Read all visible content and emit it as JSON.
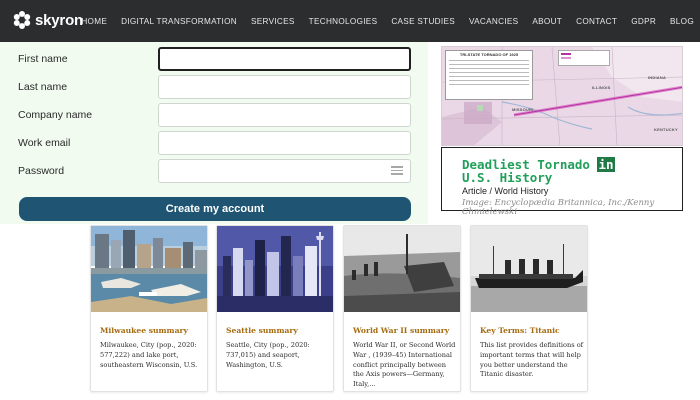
{
  "brand": {
    "name": "skyron"
  },
  "nav": {
    "items": [
      "HOME",
      "DIGITAL TRANSFORMATION",
      "SERVICES",
      "TECHNOLOGIES",
      "CASE STUDIES",
      "VACANCIES",
      "ABOUT",
      "CONTACT",
      "GDPR",
      "BLOG"
    ]
  },
  "form": {
    "first_name": {
      "label": "First name",
      "value": ""
    },
    "last_name": {
      "label": "Last name",
      "value": ""
    },
    "company_name": {
      "label": "Company name",
      "value": ""
    },
    "work_email": {
      "label": "Work email",
      "value": ""
    },
    "password": {
      "label": "Password",
      "value": ""
    },
    "submit_label": "Create my account"
  },
  "ad": {
    "map_inset_title": "TRI-STATE TORNADO OF 1925",
    "map_states": [
      "MISSOURI",
      "ILLINOIS",
      "INDIANA",
      "KENTUCKY"
    ],
    "title_part1": "Deadliest Tornado",
    "title_highlight": "in",
    "title_part2": "U.S. History",
    "subtitle": "Article / World History",
    "credit": "Image: Encyclopædia Britannica, Inc./Kenny Chmielewski"
  },
  "cards": [
    {
      "title": "Milwaukee summary",
      "desc": "Milwaukee, City (pop., 2020: 577,222) and lake port, southeastern Wisconsin, U.S."
    },
    {
      "title": "Seattle summary",
      "desc": "Seattle, City (pop., 2020: 737,015) and seaport, Washington, U.S."
    },
    {
      "title": "World War II summary",
      "desc": "World War II, or Second World War , (1939–45) International conflict principally between the Axis powers—Germany, Italy,..."
    },
    {
      "title": "Key Terms: Titanic",
      "desc": "This list provides definitions of important terms that will help you better understand the Titanic disaster."
    }
  ],
  "colors": {
    "topbar": "#2b2d2f",
    "form_bg": "#f1fbf0",
    "button": "#1f5572",
    "ad_title": "#21a05a",
    "card_title": "#a56b10"
  }
}
